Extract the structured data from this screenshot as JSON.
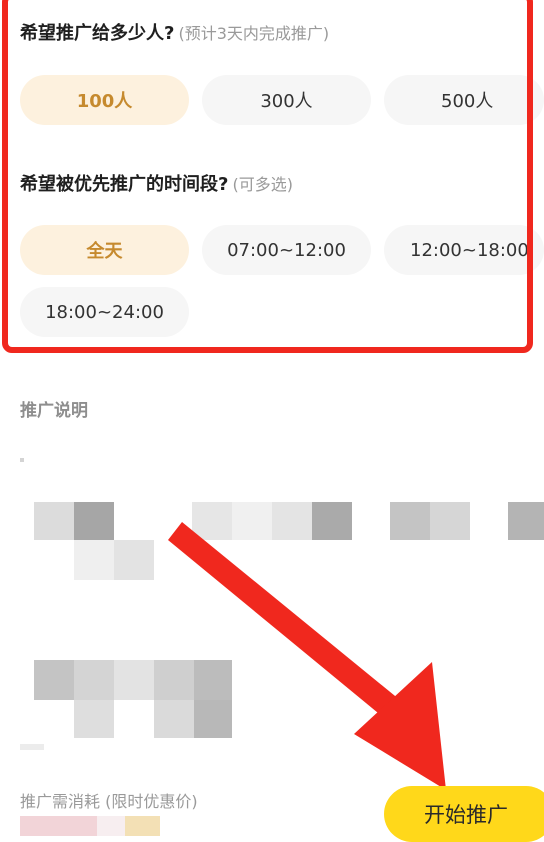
{
  "count_section": {
    "title": "希望推广给多少人?",
    "hint": "(预计3天内完成推广)",
    "options": [
      "100人",
      "300人",
      "500人"
    ],
    "selected": "100人"
  },
  "time_section": {
    "title": "希望被优先推广的时间段?",
    "hint": "(可多选)",
    "options": [
      "全天",
      "07:00~12:00",
      "12:00~18:00",
      "18:00~24:00"
    ],
    "selected": "全天"
  },
  "description": {
    "label": "推广说明"
  },
  "footer": {
    "cost_label": "推广需消耗 (限时优惠价)",
    "start_button": "开始推广"
  },
  "colors": {
    "highlight": "#f0281e",
    "selected_bg": "#fdf1de",
    "selected_text": "#c68a2e",
    "button": "#ffd81a",
    "arrow": "#f0281e"
  },
  "icons": {
    "annotation_arrow": "red-arrow-icon"
  }
}
